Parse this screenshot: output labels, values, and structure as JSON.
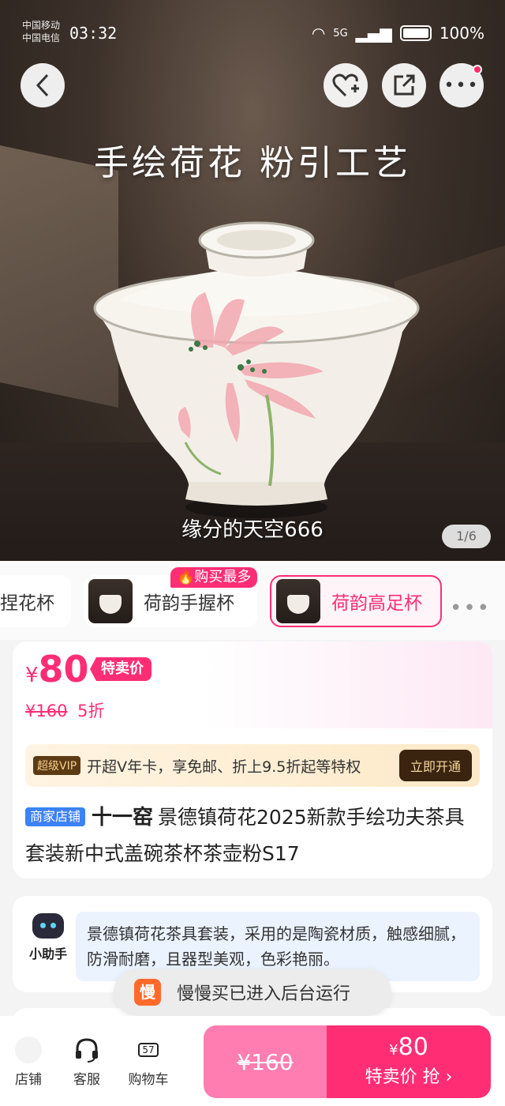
{
  "status_bar": {
    "carrier1": "中国移动",
    "carrier2": "中国电信",
    "time": "03:32",
    "network": "5G",
    "battery": "100%"
  },
  "hero": {
    "title": "手绘荷花 粉引工艺",
    "watermark": "缘分的天空666",
    "pager": "1/6"
  },
  "variants": {
    "hot_tag": "🔥购买最多",
    "items": [
      {
        "label": "捏花杯"
      },
      {
        "label": "荷韵手握杯"
      },
      {
        "label": "荷韵高足杯"
      }
    ],
    "more": "•••"
  },
  "price": {
    "currency": "¥",
    "current": "80",
    "badge": "特卖价",
    "original": "¥160",
    "discount": "5折"
  },
  "vip": {
    "tag": "超级VIP",
    "text": "开超V年卡，享免邮、折上9.5折起等特权",
    "button": "立即开通"
  },
  "product": {
    "shop_tag": "商家店铺",
    "brand": "十一窑",
    "title": "景德镇荷花2025新款手绘功夫茶具套装新中式盖碗茶杯茶壶粉S17"
  },
  "assistant": {
    "name": "小助手",
    "text": "景德镇荷花茶具套装，采用的是陶瓷材质，触感细腻，防滑耐磨，且器型美观，色彩艳丽。"
  },
  "toast": {
    "icon": "慢",
    "text": "慢慢买已进入后台运行"
  },
  "bottom_bar": {
    "shop": "店铺",
    "service": "客服",
    "cart": "购物车",
    "cart_count": "57",
    "old_price": "¥160",
    "buy_price_cur": "¥",
    "buy_price": "80",
    "buy_label": "特卖价 抢"
  },
  "colors": {
    "accent": "#ff2e74",
    "vip_dark": "#3a2410"
  }
}
